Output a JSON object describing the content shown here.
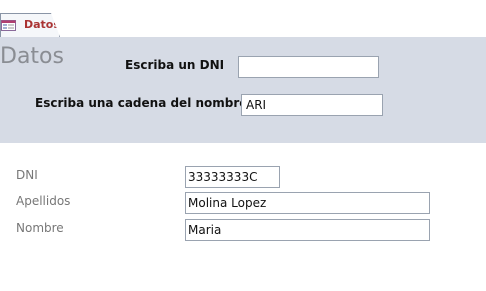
{
  "tab": {
    "label": "Datos",
    "icon": "form-icon"
  },
  "form": {
    "title": "Datos"
  },
  "search": {
    "dni_label": "Escriba un DNI",
    "dni_value": "",
    "name_label": "Escriba una cadena del nombre",
    "name_value": "ARI"
  },
  "record": {
    "dni_label": "DNI",
    "dni_value": "33333333C",
    "apellidos_label": "Apellidos",
    "apellidos_value": "Molina Lopez",
    "nombre_label": "Nombre",
    "nombre_value": "Maria"
  },
  "colors": {
    "header_bg": "#d6dbe5",
    "tab_text": "#aa3333"
  }
}
